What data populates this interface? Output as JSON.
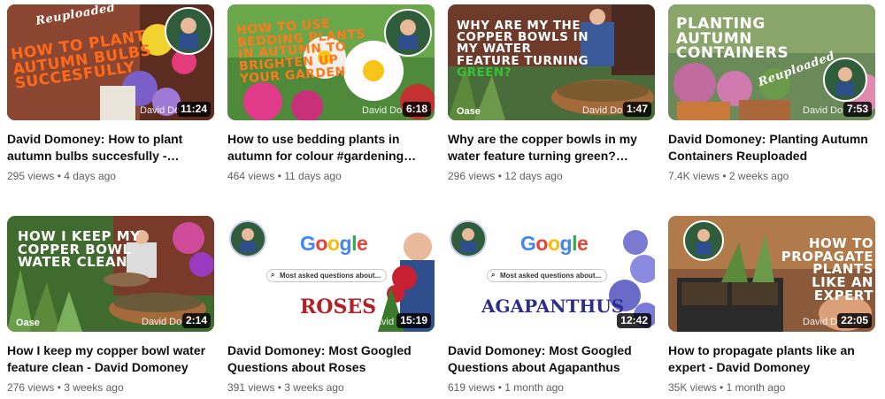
{
  "videos": [
    {
      "title": "David Domoney: How to plant autumn bulbs succesfully - reuploaded",
      "views": "295 views",
      "age": "4 days ago",
      "duration": "11:24",
      "thumb_text": "How to plant autumn bulbs succesfully",
      "thumb_tag": "Reuploaded",
      "watermark": "David Do"
    },
    {
      "title": "How to use bedding plants in autumn for colour #gardening #autumn",
      "views": "464 views",
      "age": "11 days ago",
      "duration": "6:18",
      "thumb_text": "How to use bedding plants in autumn to brighten up your garden",
      "watermark": "David Do"
    },
    {
      "title": "Why are the copper bowls in my water feature turning green? #gardening",
      "views": "296 views",
      "age": "12 days ago",
      "duration": "1:47",
      "thumb_text": "Why are my the copper bowls in my water feature turning",
      "thumb_highlight": "green?",
      "oase": "Oase",
      "watermark": "David Do"
    },
    {
      "title": "David Domoney: Planting Autumn Containers Reuploaded",
      "views": "7.4K views",
      "age": "2 weeks ago",
      "duration": "7:53",
      "thumb_text": "Planting autumn containers",
      "thumb_tag": "Reuploaded",
      "watermark": "David Do"
    },
    {
      "title": "How I keep my copper bowl water feature clean - David Domoney",
      "views": "276 views",
      "age": "3 weeks ago",
      "duration": "2:14",
      "thumb_text": "How I keep my copper bowl water clean",
      "oase": "Oase",
      "watermark": "David Do"
    },
    {
      "title": "David Domoney: Most Googled Questions about Roses",
      "views": "391 views",
      "age": "3 weeks ago",
      "duration": "15:19",
      "google": "Google",
      "search_text": "Most asked questions about...",
      "big_word": "ROSES",
      "watermark": "David"
    },
    {
      "title": "David Domoney: Most Googled Questions about Agapanthus",
      "views": "619 views",
      "age": "1 month ago",
      "duration": "12:42",
      "google": "Google",
      "search_text": "Most asked questions about...",
      "big_word": "AGAPANTHUS",
      "watermark": "David"
    },
    {
      "title": "How to propagate plants like an expert - David Domoney",
      "views": "35K views",
      "age": "1 month ago",
      "duration": "22:05",
      "thumb_text": "How to propagate plants like an expert",
      "watermark": "David Do"
    }
  ],
  "meta_separator": "•",
  "colors": {
    "accent_orange": "#ff6a1a",
    "google_blue": "#4285F4",
    "google_red": "#EA4335",
    "google_yellow": "#FBBC05",
    "google_green": "#34A853",
    "roses_red": "#b3202a",
    "agapanthus_blue": "#2d2c8f",
    "duration_bg": "#000000cc"
  }
}
